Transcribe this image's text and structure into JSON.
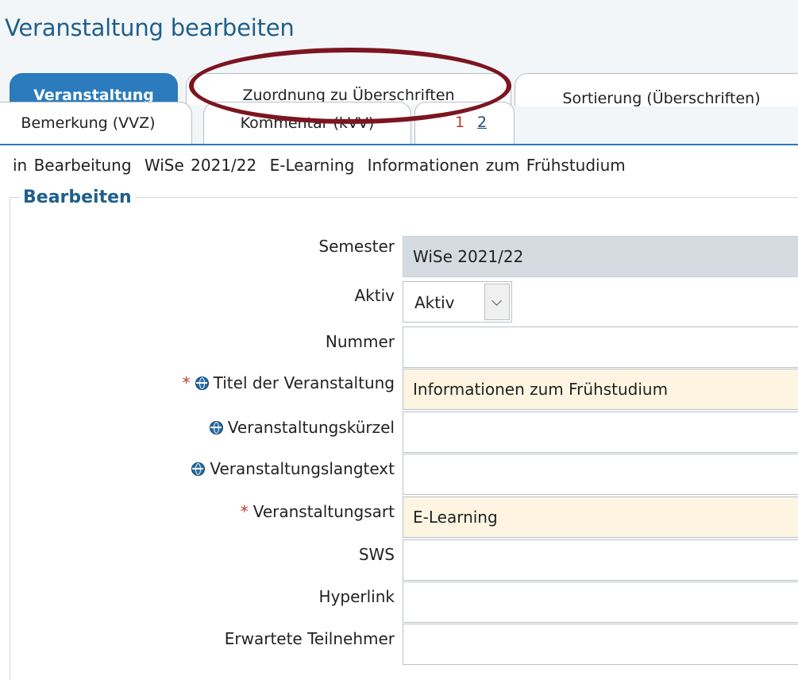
{
  "page": {
    "title": "Veranstaltung bearbeiten"
  },
  "tabs": {
    "row1": [
      {
        "label": "Veranstaltung",
        "active": true
      },
      {
        "label": "Zuordnung zu Überschriften",
        "active": false
      },
      {
        "label": "Sortierung (Überschriften)",
        "active": false
      }
    ],
    "row2": [
      {
        "label": "Bemerkung (VVZ)",
        "active": false
      },
      {
        "label": "Kommentar (kVV)",
        "active": false
      }
    ],
    "pages": {
      "current": "1",
      "other": "2"
    }
  },
  "status": {
    "state": "in Bearbeitung",
    "semester": "WiSe 2021/22",
    "type": "E-Learning",
    "title": "Informationen zum Frühstudium"
  },
  "section": {
    "legend": "Bearbeiten"
  },
  "form": {
    "semester": {
      "label": "Semester",
      "value": "WiSe 2021/22"
    },
    "aktiv": {
      "label": "Aktiv",
      "value": "Aktiv"
    },
    "nummer": {
      "label": "Nummer",
      "value": ""
    },
    "titel": {
      "label": "Titel der Veranstaltung",
      "value": "Informationen zum Frühstudium",
      "required_mark": "*"
    },
    "kuerzel": {
      "label": "Veranstaltungskürzel",
      "value": ""
    },
    "langtext": {
      "label": "Veranstaltungslangtext",
      "value": ""
    },
    "art": {
      "label": "Veranstaltungsart",
      "value": "E-Learning",
      "required_mark": "*"
    },
    "sws": {
      "label": "SWS",
      "value": ""
    },
    "hyperlink": {
      "label": "Hyperlink",
      "value": ""
    },
    "teilnehmer": {
      "label": "Erwartete Teilnehmer",
      "value": ""
    }
  },
  "colors": {
    "accent": "#2b7bbd",
    "title": "#1f5f8b",
    "required": "#c0392b",
    "annotation": "#7b1620",
    "readonly_bg": "#d6dbe2",
    "required_bg": "#fdf5e2"
  },
  "icons": {
    "multilingual": "globe-icon",
    "dropdown": "chevron-down-icon"
  }
}
